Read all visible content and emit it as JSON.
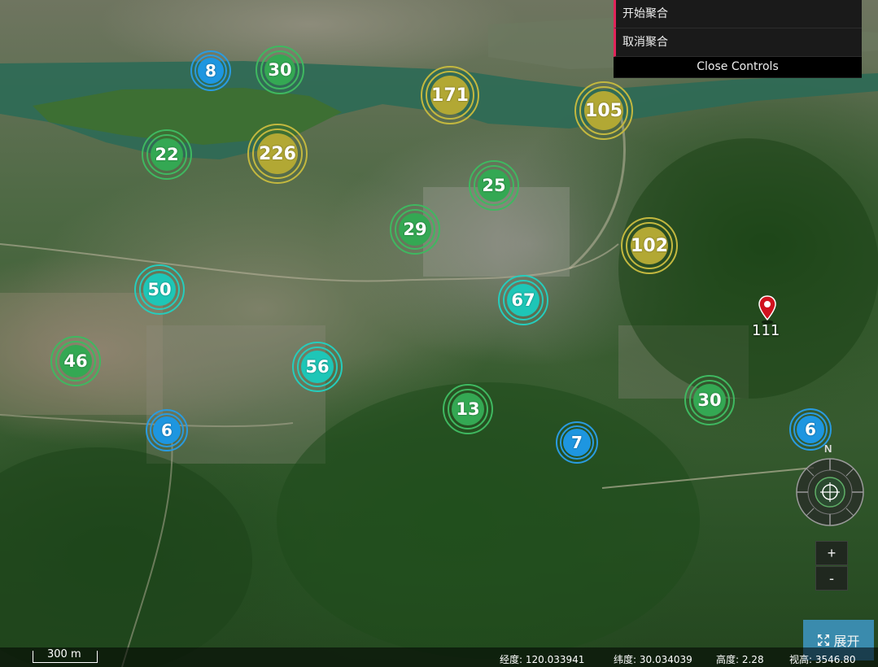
{
  "clusters": [
    {
      "id": "c8",
      "count": "8",
      "color": "blue"
    },
    {
      "id": "c30a",
      "count": "30",
      "color": "green"
    },
    {
      "id": "c171",
      "count": "171",
      "color": "olive"
    },
    {
      "id": "c105",
      "count": "105",
      "color": "olive"
    },
    {
      "id": "c22",
      "count": "22",
      "color": "green"
    },
    {
      "id": "c226",
      "count": "226",
      "color": "olive"
    },
    {
      "id": "c25",
      "count": "25",
      "color": "green"
    },
    {
      "id": "c29",
      "count": "29",
      "color": "green"
    },
    {
      "id": "c102",
      "count": "102",
      "color": "olive"
    },
    {
      "id": "c50",
      "count": "50",
      "color": "teal"
    },
    {
      "id": "c67",
      "count": "67",
      "color": "teal"
    },
    {
      "id": "c46",
      "count": "46",
      "color": "green"
    },
    {
      "id": "c56",
      "count": "56",
      "color": "teal"
    },
    {
      "id": "c13",
      "count": "13",
      "color": "green"
    },
    {
      "id": "c30b",
      "count": "30",
      "color": "green"
    },
    {
      "id": "c6a",
      "count": "6",
      "color": "blue"
    },
    {
      "id": "c7",
      "count": "7",
      "color": "blue"
    },
    {
      "id": "c6b",
      "count": "6",
      "color": "blue"
    }
  ],
  "pin": {
    "label": "111",
    "icon": "map-pin-icon",
    "color": "#d0121e"
  },
  "controls": {
    "start_cluster": "开始聚合",
    "cancel_cluster": "取消聚合",
    "close": "Close Controls"
  },
  "compass": {
    "north": "N"
  },
  "zoom": {
    "in": "+",
    "out": "-"
  },
  "expand": {
    "label": "展开",
    "icon": "expand-icon"
  },
  "status": {
    "scale": "300 m",
    "longitude": "经度: 120.033941",
    "latitude": "纬度: 30.034039",
    "height": "高度: 2.28",
    "view_height": "视高: 3546.80"
  },
  "colors": {
    "blue": "#1e96e0",
    "green": "#34a853",
    "teal": "#1ec6b7",
    "olive": "#b2a834",
    "control_accent": "#e1245a"
  }
}
